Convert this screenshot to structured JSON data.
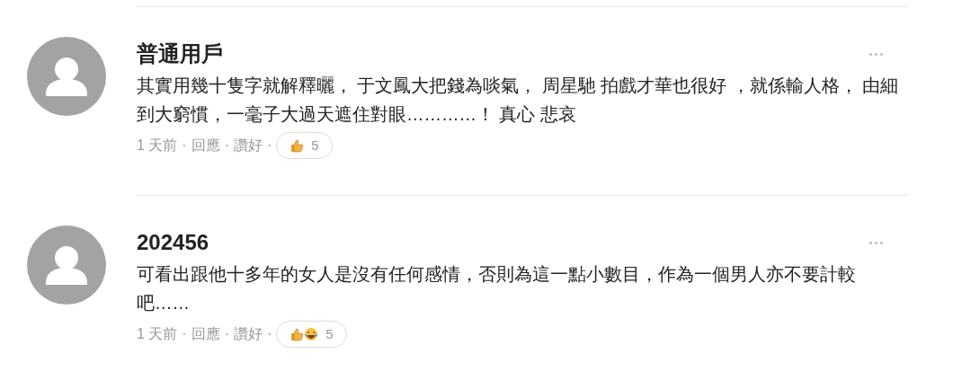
{
  "comments": [
    {
      "author": "普通用戶",
      "text": "其實用幾十隻字就解釋曬， 于文鳳大把錢為啖氣， 周星馳 拍戲才華也很好 ，就係輸人格， 由細到大窮慣，一毫子大過天遮住對眼…………！ 真心 悲哀",
      "time": "1 天前",
      "separator": "·",
      "reply": "回應",
      "like": "讚好",
      "reactions": [
        {
          "kind": "thumbs-up"
        }
      ],
      "count": "5"
    },
    {
      "author": "202456",
      "text": "可看出跟他十多年的女人是沒有任何感情，否則為這一點小數目，作為一個男人亦不要計較吧……",
      "time": "1 天前",
      "separator": "·",
      "reply": "回應",
      "like": "讚好",
      "reactions": [
        {
          "kind": "thumbs-up"
        },
        {
          "kind": "laughing"
        }
      ],
      "count": "5"
    }
  ]
}
